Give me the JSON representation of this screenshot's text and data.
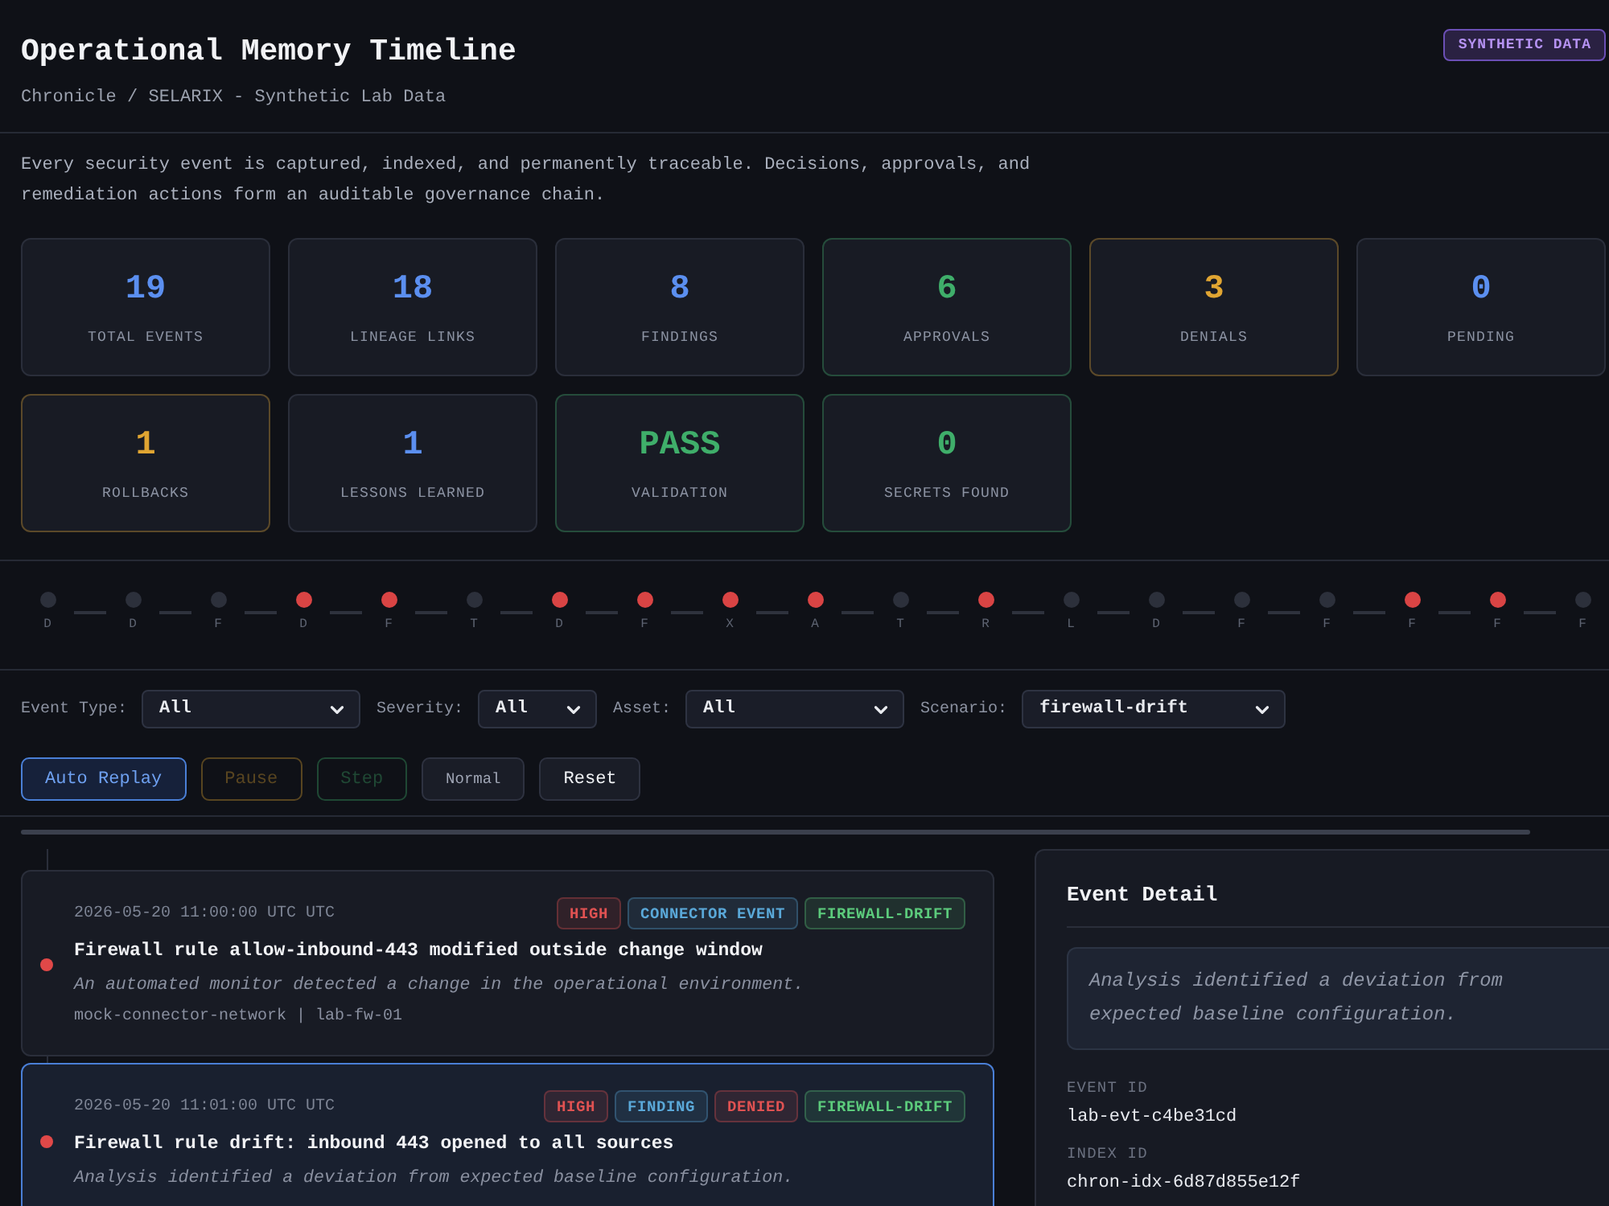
{
  "header": {
    "title": "Operational Memory Timeline",
    "breadcrumb": "Chronicle / SELARIX - Synthetic Lab Data",
    "badge": "SYNTHETIC DATA"
  },
  "intro": "Every security event is captured, indexed, and permanently traceable. Decisions, approvals, and remediation actions form an auditable governance chain.",
  "stats": [
    {
      "value": "19",
      "label": "TOTAL EVENTS",
      "color": "#5b8ff0",
      "outlined": false
    },
    {
      "value": "18",
      "label": "LINEAGE LINKS",
      "color": "#5b8ff0",
      "outlined": false
    },
    {
      "value": "8",
      "label": "FINDINGS",
      "color": "#5b8ff0",
      "outlined": false
    },
    {
      "value": "6",
      "label": "APPROVALS",
      "color": "#3fae6a",
      "outlined": true
    },
    {
      "value": "3",
      "label": "DENIALS",
      "color": "#e0a532",
      "outlined": true
    },
    {
      "value": "0",
      "label": "PENDING",
      "color": "#5b8ff0",
      "outlined": false
    },
    {
      "value": "1",
      "label": "ROLLBACKS",
      "color": "#e0a532",
      "outlined": true
    },
    {
      "value": "1",
      "label": "LESSONS LEARNED",
      "color": "#5b8ff0",
      "outlined": false
    },
    {
      "value": "PASS",
      "label": "VALIDATION",
      "color": "#3fae6a",
      "outlined": true
    },
    {
      "value": "0",
      "label": "SECRETS FOUND",
      "color": "#3fae6a",
      "outlined": true
    }
  ],
  "timeline": [
    {
      "label": "D",
      "color": "#2c303b"
    },
    {
      "label": "D",
      "color": "#2c303b"
    },
    {
      "label": "F",
      "color": "#2c303b"
    },
    {
      "label": "D",
      "color": "#d94444"
    },
    {
      "label": "F",
      "color": "#d94444"
    },
    {
      "label": "T",
      "color": "#2c303b"
    },
    {
      "label": "D",
      "color": "#d94444"
    },
    {
      "label": "F",
      "color": "#d94444"
    },
    {
      "label": "X",
      "color": "#d94444"
    },
    {
      "label": "A",
      "color": "#d94444"
    },
    {
      "label": "T",
      "color": "#2c303b"
    },
    {
      "label": "R",
      "color": "#d94444"
    },
    {
      "label": "L",
      "color": "#2c303b"
    },
    {
      "label": "D",
      "color": "#2c303b"
    },
    {
      "label": "F",
      "color": "#2c303b"
    },
    {
      "label": "F",
      "color": "#2c303b"
    },
    {
      "label": "F",
      "color": "#d94444"
    },
    {
      "label": "F",
      "color": "#d94444"
    },
    {
      "label": "F",
      "color": "#2c303b"
    }
  ],
  "filters": [
    {
      "label": "Event Type:",
      "value": "All"
    },
    {
      "label": "Severity:",
      "value": "All"
    },
    {
      "label": "Asset:",
      "value": "All"
    },
    {
      "label": "Scenario:",
      "value": "firewall-drift"
    }
  ],
  "controls": [
    {
      "label": "Auto Replay",
      "kind": "primary",
      "disabled": false
    },
    {
      "label": "Pause",
      "kind": "warning",
      "disabled": true
    },
    {
      "label": "Step",
      "kind": "success",
      "disabled": true
    },
    {
      "label": "Normal",
      "kind": "small",
      "disabled": false
    },
    {
      "label": "Reset",
      "kind": "default",
      "disabled": false
    }
  ],
  "events": [
    {
      "timestamp": "2026-05-20 11:00:00 UTC UTC",
      "badges": [
        {
          "text": "HIGH",
          "color": "#e05252"
        },
        {
          "text": "CONNECTOR EVENT",
          "color": "#5aa8d8"
        },
        {
          "text": "FIREWALL-DRIFT",
          "color": "#5ccb7c"
        }
      ],
      "title": "Firewall rule allow-inbound-443 modified outside change window",
      "description": "An automated monitor detected a change in the operational environment.",
      "meta": "mock-connector-network | lab-fw-01",
      "color": "#e04848",
      "selected": false
    },
    {
      "timestamp": "2026-05-20 11:01:00 UTC UTC",
      "badges": [
        {
          "text": "HIGH",
          "color": "#e05252"
        },
        {
          "text": "FINDING",
          "color": "#5aa8d8"
        },
        {
          "text": "DENIED",
          "color": "#e05252"
        },
        {
          "text": "FIREWALL-DRIFT",
          "color": "#5ccb7c"
        }
      ],
      "title": "Firewall rule drift: inbound 443 opened to all sources",
      "description": "Analysis identified a deviation from expected baseline configuration.",
      "color": "#e04848",
      "selected": true
    }
  ],
  "detail": {
    "title": "Event Detail",
    "summary": "Analysis identified a deviation from expected baseline configuration.",
    "fields": [
      {
        "label": "EVENT ID",
        "value": "lab-evt-c4be31cd"
      },
      {
        "label": "INDEX ID",
        "value": "chron-idx-6d87d855e12f"
      }
    ]
  }
}
